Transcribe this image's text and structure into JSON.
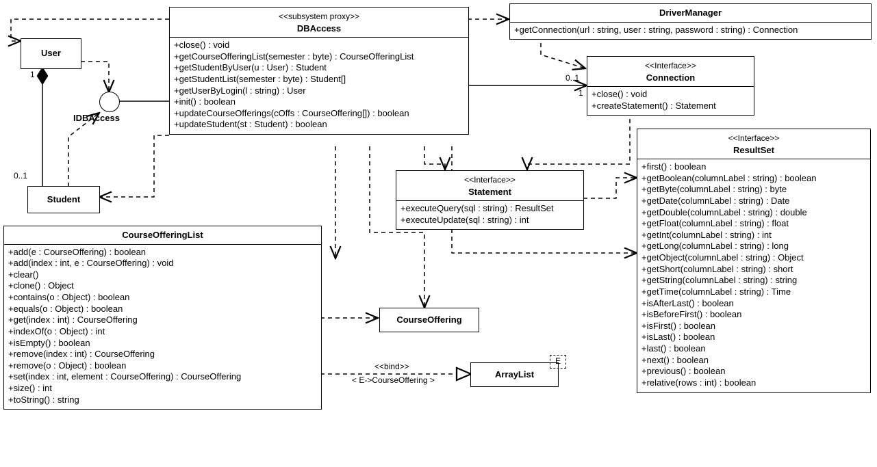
{
  "classes": {
    "user": {
      "name": "User"
    },
    "student": {
      "name": "Student"
    },
    "idbaccess": {
      "name": "IDBAccess"
    },
    "dbaccess": {
      "stereo": "<<subsystem proxy>>",
      "name": "DBAccess",
      "ops": [
        "+close() : void",
        "+getCourseOfferingList(semester : byte) : CourseOfferingList",
        "+getStudentByUser(u : User) : Student",
        "+getStudentList(semester : byte) : Student[]",
        "+getUserByLogin(l : string) : User",
        "+init() : boolean",
        "+updateCourseOfferings(cOffs : CourseOffering[]) : boolean",
        "+updateStudent(st : Student) : boolean"
      ]
    },
    "drivermanager": {
      "name": "DriverManager",
      "ops": [
        "+getConnection(url : string, user : string, password : string) : Connection"
      ]
    },
    "connection": {
      "stereo": "<<Interface>>",
      "name": "Connection",
      "ops": [
        "+close() : void",
        "+createStatement() : Statement"
      ]
    },
    "statement": {
      "stereo": "<<Interface>>",
      "name": "Statement",
      "ops": [
        "+executeQuery(sql : string) : ResultSet",
        "+executeUpdate(sql : string) : int"
      ]
    },
    "resultset": {
      "stereo": "<<Interface>>",
      "name": "ResultSet",
      "ops": [
        "+first() : boolean",
        "+getBoolean(columnLabel : string) : boolean",
        "+getByte(columnLabel : string) : byte",
        "+getDate(columnLabel : string) : Date",
        "+getDouble(columnLabel : string) : double",
        "+getFloat(columnLabel : string) : float",
        "+getInt(columnLabel : string) : int",
        "+getLong(columnLabel : string) : long",
        "+getObject(columnLabel : string) : Object",
        "+getShort(columnLabel : string) : short",
        "+getString(columnLabel : string) : string",
        "+getTime(columnLabel : string) : Time",
        "+isAfterLast() : boolean",
        "+isBeforeFirst() : boolean",
        "+isFirst() : boolean",
        "+isLast() : boolean",
        "+last() : boolean",
        "+next() : boolean",
        "+previous() : boolean",
        "+relative(rows : int) : boolean"
      ]
    },
    "courseofferinglist": {
      "name": "CourseOfferingList",
      "ops": [
        "+add(e : CourseOffering) : boolean",
        "+add(index : int, e : CourseOffering) : void",
        "+clear()",
        "+clone() : Object",
        "+contains(o : Object) : boolean",
        "+equals(o : Object) : boolean",
        "+get(index : int) : CourseOffering",
        "+indexOf(o : Object) : int",
        "+isEmpty() : boolean",
        "+remove(index : int) : CourseOffering",
        "+remove(o : Object) : boolean",
        "+set(index : int, element : CourseOffering) : CourseOffering",
        "+size() : int",
        "+toString() : string"
      ]
    },
    "courseoffering": {
      "name": "CourseOffering"
    },
    "arraylist": {
      "name": "ArrayList",
      "param": "E"
    }
  },
  "labels": {
    "bind": "<<bind>>",
    "bindparam": "< E->CourseOffering >"
  },
  "mult": {
    "user1": "1",
    "student01": "0..1",
    "conn01": "0..1",
    "conn1": "1"
  }
}
